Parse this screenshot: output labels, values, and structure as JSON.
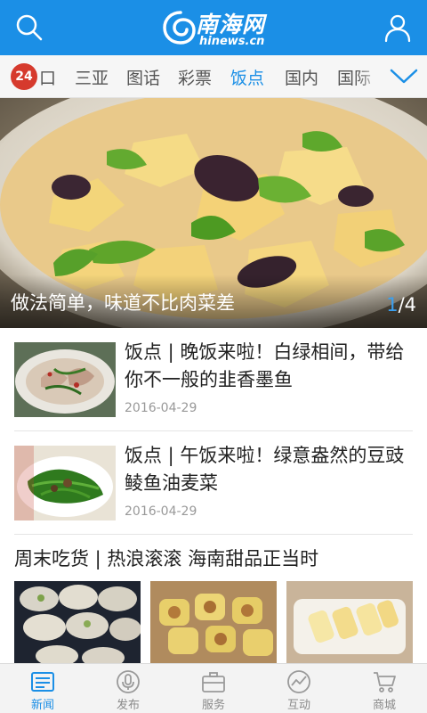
{
  "header": {
    "logo_title": "南海网",
    "logo_sub": "hinews.cn",
    "search_icon": "search-icon",
    "user_icon": "user-icon",
    "bg_color": "#1b8fe6"
  },
  "tabs": {
    "badge": "24",
    "items": [
      "口",
      "三亚",
      "图话",
      "彩票",
      "饭点",
      "国内",
      "国际"
    ],
    "active": "饭点",
    "expand_icon": "chevron-down-icon"
  },
  "hero": {
    "caption": "做法简单，味道不比肉菜差",
    "page_current": "1",
    "page_total": "/4"
  },
  "news": [
    {
      "title": "饭点 | 晚饭来啦！白绿相间，带给你不一般的韭香墨鱼",
      "date": "2016-04-29"
    },
    {
      "title": "饭点 | 午饭来啦！绿意盎然的豆豉鲮鱼油麦菜",
      "date": "2016-04-29"
    }
  ],
  "section": {
    "title": "周末吃货 | 热浪滚滚 海南甜品正当时"
  },
  "bottom_nav": [
    {
      "label": "新闻",
      "icon": "news-icon"
    },
    {
      "label": "发布",
      "icon": "microphone-icon"
    },
    {
      "label": "服务",
      "icon": "briefcase-icon"
    },
    {
      "label": "互动",
      "icon": "trend-icon"
    },
    {
      "label": "商城",
      "icon": "cart-icon"
    }
  ],
  "active_nav": "新闻",
  "accent_color": "#1b8fe6"
}
